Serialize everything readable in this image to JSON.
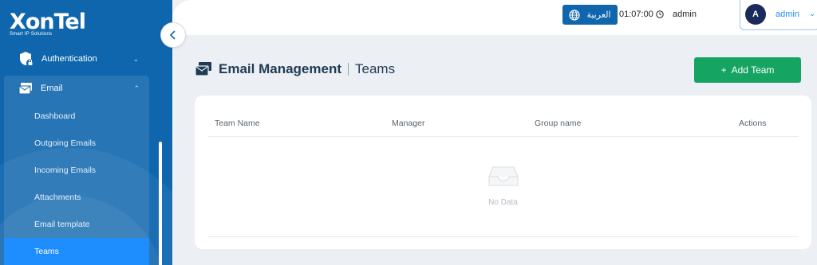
{
  "brand": {
    "name": "XonTel",
    "tagline": "Smart IP Solutions"
  },
  "sidebar": {
    "authentication_label": "Authentication",
    "email_label": "Email",
    "email_items": [
      {
        "label": "Dashboard"
      },
      {
        "label": "Outgoing Emails"
      },
      {
        "label": "Incoming Emails"
      },
      {
        "label": "Attachments"
      },
      {
        "label": "Email template"
      },
      {
        "label": "Teams"
      }
    ]
  },
  "header": {
    "language_label": "العربية",
    "time": "01:07:00",
    "username": "admin",
    "avatar_letter": "A",
    "menu_username": "admin"
  },
  "page": {
    "title": "Email Management",
    "subtitle": "Teams",
    "add_button_label": "Add Team"
  },
  "table": {
    "columns": [
      "Team Name",
      "Manager",
      "Group name",
      "Actions"
    ],
    "empty_text": "No Data"
  },
  "colors": {
    "sidebar": "#0f66ad",
    "active": "#1e8eff",
    "add_button": "#16a463"
  }
}
